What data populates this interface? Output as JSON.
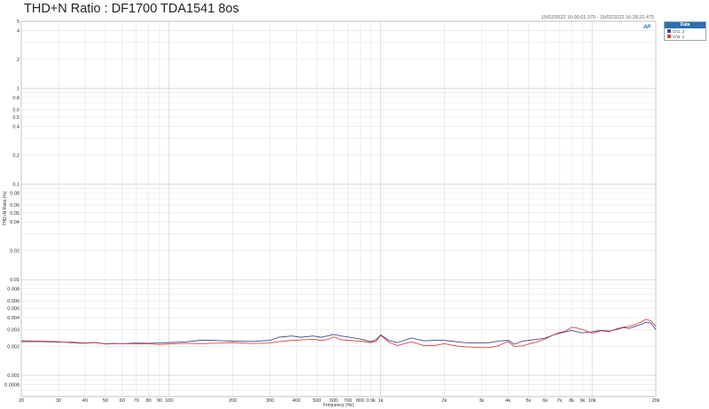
{
  "chart_data": {
    "type": "line",
    "title": "THD+N Ratio : DF1700 TDA1541 8os",
    "subtitle": "15/02/2022 16:00:01.370 - 15/02/2022 16:28:22.475",
    "xlabel": "Frequency (Hz)",
    "ylabel": "THD+N Ratio (%)",
    "x_scale": "log",
    "y_scale": "log",
    "xlim": [
      20,
      20000
    ],
    "ylim": [
      0.0006,
      5
    ],
    "grid": true,
    "legend_position": "right",
    "legend_title": "Data",
    "x_ticks": [
      {
        "v": 20,
        "label": "20"
      },
      {
        "v": 30,
        "label": "30"
      },
      {
        "v": 40,
        "label": "40"
      },
      {
        "v": 50,
        "label": "50"
      },
      {
        "v": 60,
        "label": "60"
      },
      {
        "v": 70,
        "label": "70"
      },
      {
        "v": 80,
        "label": "80"
      },
      {
        "v": 90,
        "label": "90"
      },
      {
        "v": 100,
        "label": "100"
      },
      {
        "v": 200,
        "label": "200"
      },
      {
        "v": 300,
        "label": "300"
      },
      {
        "v": 400,
        "label": "400"
      },
      {
        "v": 500,
        "label": "500"
      },
      {
        "v": 600,
        "label": "600"
      },
      {
        "v": 700,
        "label": "700"
      },
      {
        "v": 800,
        "label": "800"
      },
      {
        "v": 900,
        "label": "0.9k"
      },
      {
        "v": 1000,
        "label": "1k"
      },
      {
        "v": 2000,
        "label": "2k"
      },
      {
        "v": 3000,
        "label": "3k"
      },
      {
        "v": 4000,
        "label": "4k"
      },
      {
        "v": 5000,
        "label": "5k"
      },
      {
        "v": 6000,
        "label": "6k"
      },
      {
        "v": 7000,
        "label": "7k"
      },
      {
        "v": 8000,
        "label": "8k"
      },
      {
        "v": 9000,
        "label": "9k"
      },
      {
        "v": 10000,
        "label": "10k"
      },
      {
        "v": 20000,
        "label": "20k"
      }
    ],
    "y_ticks": [
      {
        "v": 5,
        "label": "5"
      },
      {
        "v": 4,
        "label": "4"
      },
      {
        "v": 2,
        "label": "2"
      },
      {
        "v": 1,
        "label": "1"
      },
      {
        "v": 0.8,
        "label": "0.8"
      },
      {
        "v": 0.6,
        "label": "0.6"
      },
      {
        "v": 0.5,
        "label": "0.5"
      },
      {
        "v": 0.4,
        "label": "0.4"
      },
      {
        "v": 0.2,
        "label": "0.2"
      },
      {
        "v": 0.1,
        "label": "0.1"
      },
      {
        "v": 0.08,
        "label": "0.08"
      },
      {
        "v": 0.06,
        "label": "0.06"
      },
      {
        "v": 0.05,
        "label": "0.05"
      },
      {
        "v": 0.04,
        "label": "0.04"
      },
      {
        "v": 0.02,
        "label": "0.02"
      },
      {
        "v": 0.01,
        "label": "0.01"
      },
      {
        "v": 0.008,
        "label": "0.008"
      },
      {
        "v": 0.006,
        "label": "0.006"
      },
      {
        "v": 0.005,
        "label": "0.005"
      },
      {
        "v": 0.004,
        "label": "0.004"
      },
      {
        "v": 0.003,
        "label": "0.003"
      },
      {
        "v": 0.002,
        "label": "0.002"
      },
      {
        "v": 0.001,
        "label": "0.001"
      },
      {
        "v": 0.0008,
        "label": "0.0008"
      }
    ],
    "series": [
      {
        "name": "Ch1: 2",
        "color": "#4a4a8a",
        "x": [
          20,
          25,
          30,
          35,
          40,
          45,
          50,
          55,
          60,
          70,
          80,
          90,
          100,
          120,
          140,
          160,
          180,
          200,
          250,
          300,
          330,
          380,
          420,
          480,
          520,
          560,
          600,
          650,
          700,
          800,
          900,
          950,
          1000,
          1100,
          1200,
          1400,
          1600,
          1800,
          2000,
          2300,
          2600,
          3000,
          3300,
          3600,
          4000,
          4300,
          4700,
          5000,
          5500,
          6000,
          6500,
          7000,
          7500,
          8000,
          8500,
          9000,
          10000,
          11000,
          12000,
          13000,
          14000,
          15000,
          16000,
          17000,
          18000,
          19000,
          20000
        ],
        "y": [
          0.00225,
          0.00225,
          0.00222,
          0.00222,
          0.00218,
          0.0022,
          0.00214,
          0.00216,
          0.00214,
          0.00218,
          0.00216,
          0.00218,
          0.0022,
          0.00224,
          0.00232,
          0.00232,
          0.0023,
          0.00228,
          0.00226,
          0.00232,
          0.0025,
          0.00258,
          0.0025,
          0.00258,
          0.0025,
          0.00258,
          0.00268,
          0.00258,
          0.00252,
          0.0024,
          0.00225,
          0.00235,
          0.00265,
          0.0023,
          0.0022,
          0.00245,
          0.0023,
          0.00232,
          0.00232,
          0.00224,
          0.00218,
          0.00218,
          0.0022,
          0.00228,
          0.00232,
          0.00212,
          0.00228,
          0.00232,
          0.00238,
          0.00245,
          0.00262,
          0.00275,
          0.00285,
          0.00295,
          0.00285,
          0.00278,
          0.00285,
          0.00295,
          0.0029,
          0.003,
          0.00315,
          0.0031,
          0.00325,
          0.0034,
          0.0036,
          0.0035,
          0.003
        ]
      },
      {
        "name": "Ch2: 2",
        "color": "#d04848",
        "x": [
          20,
          25,
          30,
          35,
          40,
          45,
          50,
          55,
          60,
          70,
          80,
          90,
          100,
          120,
          140,
          160,
          180,
          200,
          250,
          300,
          330,
          380,
          420,
          480,
          520,
          560,
          600,
          650,
          700,
          800,
          900,
          950,
          1000,
          1100,
          1200,
          1400,
          1600,
          1800,
          2000,
          2300,
          2600,
          3000,
          3300,
          3600,
          4000,
          4300,
          4700,
          5000,
          5500,
          6000,
          6500,
          7000,
          7500,
          8000,
          8500,
          9000,
          10000,
          11000,
          12000,
          13000,
          14000,
          15000,
          16000,
          17000,
          18000,
          19000,
          20000
        ],
        "y": [
          0.0023,
          0.00228,
          0.00225,
          0.00218,
          0.00216,
          0.0022,
          0.00212,
          0.00214,
          0.00215,
          0.00212,
          0.00214,
          0.0021,
          0.00212,
          0.00216,
          0.00214,
          0.00216,
          0.00218,
          0.0022,
          0.00215,
          0.00218,
          0.00225,
          0.00232,
          0.00235,
          0.00238,
          0.00232,
          0.00236,
          0.00252,
          0.00236,
          0.00232,
          0.00228,
          0.0022,
          0.00226,
          0.00262,
          0.0022,
          0.00205,
          0.00224,
          0.00205,
          0.00205,
          0.00214,
          0.00202,
          0.00198,
          0.00195,
          0.00196,
          0.00204,
          0.00226,
          0.002,
          0.00204,
          0.00212,
          0.00224,
          0.0024,
          0.00262,
          0.0028,
          0.0029,
          0.00318,
          0.00312,
          0.003,
          0.00275,
          0.00292,
          0.00285,
          0.00305,
          0.00318,
          0.00325,
          0.0034,
          0.0036,
          0.00385,
          0.0037,
          0.00325
        ]
      }
    ]
  },
  "badge": "AP"
}
